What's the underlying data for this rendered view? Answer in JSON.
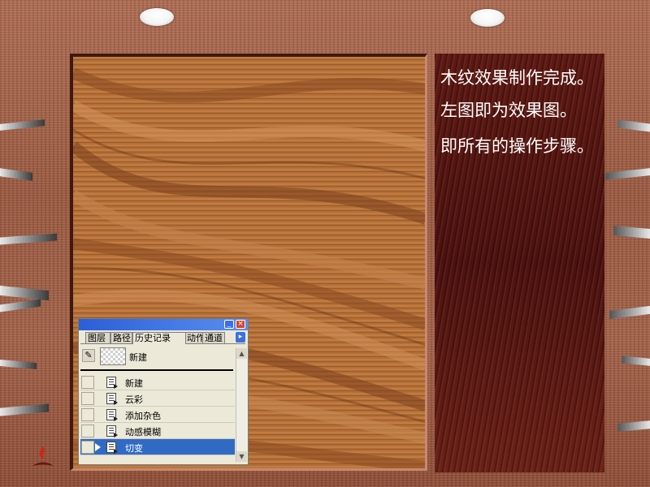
{
  "panel_text": {
    "line1": "木纹效果制作完成。",
    "line2": "左图即为效果图。",
    "line3": "即所有的操作步骤。"
  },
  "history_palette": {
    "tabs": [
      {
        "label": "图层",
        "active": false
      },
      {
        "label": "路径",
        "active": false
      },
      {
        "label": "历史记录",
        "active": true
      },
      {
        "label": "动作",
        "active": false
      },
      {
        "label": "通道",
        "active": false
      }
    ],
    "snapshot": {
      "label": "新建"
    },
    "items": [
      {
        "label": "新建",
        "selected": false
      },
      {
        "label": "云彩",
        "selected": false
      },
      {
        "label": "添加杂色",
        "selected": false
      },
      {
        "label": "动感模糊",
        "selected": false
      },
      {
        "label": "切变",
        "selected": true
      }
    ],
    "colors": {
      "titlebar": "#2a5fd8",
      "selection": "#316ac5",
      "close": "#d8452a"
    }
  },
  "colors": {
    "board": "#a5654b",
    "wood": "#b06a34",
    "panel": "#4a1310",
    "panel_text": "#ffffff"
  },
  "icons": [
    "brush-icon",
    "document-icon",
    "minimize-icon",
    "close-icon",
    "menu-arrow-icon",
    "scroll-up-icon",
    "scroll-down-icon",
    "flame-logo-icon"
  ]
}
